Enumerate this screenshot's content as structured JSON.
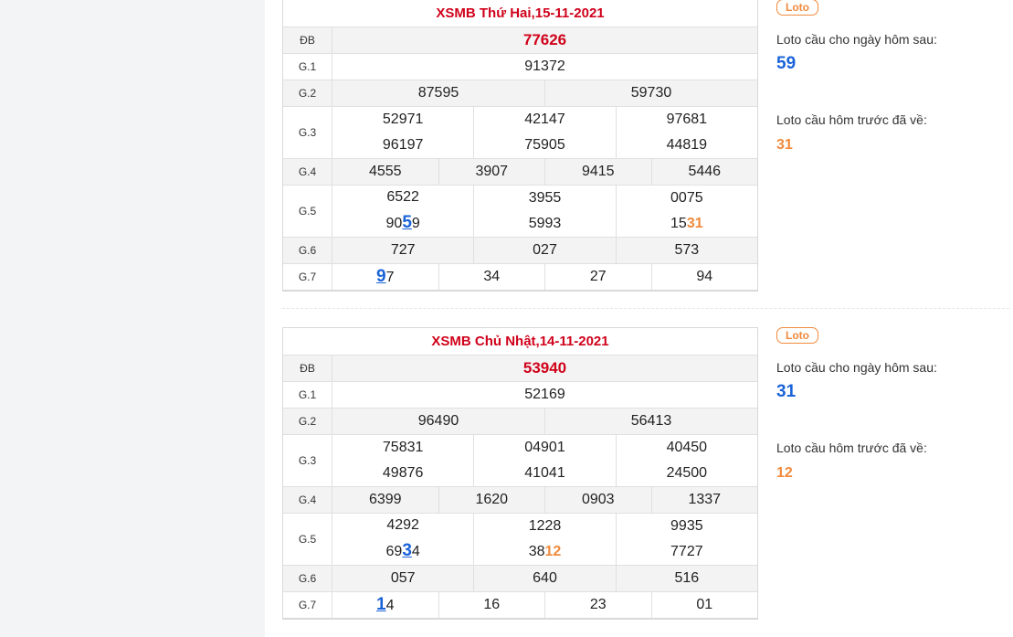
{
  "tables": [
    {
      "title": "XSMB Thứ Hai,15-11-2021",
      "rows": [
        {
          "label": "ĐB",
          "cells": [
            "77626"
          ]
        },
        {
          "label": "G.1",
          "cells": [
            "91372"
          ]
        },
        {
          "label": "G.2",
          "cells": [
            "87595",
            "59730"
          ]
        },
        {
          "label": "G.3",
          "cells": [
            [
              "52971",
              "96197"
            ],
            [
              "42147",
              "75905"
            ],
            [
              "97681",
              "44819"
            ]
          ]
        },
        {
          "label": "G.4",
          "cells": [
            "4555",
            "3907",
            "9415",
            "5446"
          ]
        },
        {
          "label": "G.5",
          "cells": [
            [
              "6522",
              {
                "parts": [
                  [
                    "90",
                    ""
                  ],
                  [
                    "5",
                    "blue"
                  ],
                  [
                    "9",
                    ""
                  ]
                ]
              }
            ],
            [
              "3955",
              "5993"
            ],
            [
              "0075",
              {
                "parts": [
                  [
                    "15",
                    ""
                  ],
                  [
                    "31",
                    "orange"
                  ]
                ]
              }
            ]
          ]
        },
        {
          "label": "G.6",
          "cells": [
            "727",
            "027",
            "573"
          ]
        },
        {
          "label": "G.7",
          "cells": [
            {
              "parts": [
                [
                  "9",
                  "blue"
                ],
                [
                  "7",
                  ""
                ]
              ]
            },
            "34",
            "27",
            "94"
          ]
        }
      ],
      "side": {
        "tag": "Loto",
        "next_label": "Loto cầu cho ngày hôm sau:",
        "next_value": "59",
        "prev_label": "Loto cầu hôm trước đã về:",
        "prev_value": "31"
      }
    },
    {
      "title": "XSMB Chủ Nhật,14-11-2021",
      "rows": [
        {
          "label": "ĐB",
          "cells": [
            "53940"
          ]
        },
        {
          "label": "G.1",
          "cells": [
            "52169"
          ]
        },
        {
          "label": "G.2",
          "cells": [
            "96490",
            "56413"
          ]
        },
        {
          "label": "G.3",
          "cells": [
            [
              "75831",
              "49876"
            ],
            [
              "04901",
              "41041"
            ],
            [
              "40450",
              "24500"
            ]
          ]
        },
        {
          "label": "G.4",
          "cells": [
            "6399",
            "1620",
            "0903",
            "1337"
          ]
        },
        {
          "label": "G.5",
          "cells": [
            [
              "4292",
              {
                "parts": [
                  [
                    "69",
                    ""
                  ],
                  [
                    "3",
                    "blue"
                  ],
                  [
                    "4",
                    ""
                  ]
                ]
              }
            ],
            [
              "1228",
              {
                "parts": [
                  [
                    "38",
                    ""
                  ],
                  [
                    "12",
                    "orange"
                  ]
                ]
              }
            ],
            [
              "9935",
              "7727"
            ]
          ]
        },
        {
          "label": "G.6",
          "cells": [
            "057",
            "640",
            "516"
          ]
        },
        {
          "label": "G.7",
          "cells": [
            {
              "parts": [
                [
                  "1",
                  "blue"
                ],
                [
                  "4",
                  ""
                ]
              ]
            },
            "16",
            "23",
            "01"
          ]
        }
      ],
      "side": {
        "tag": "Loto",
        "next_label": "Loto cầu cho ngày hôm sau:",
        "next_value": "31",
        "prev_label": "Loto cầu hôm trước đã về:",
        "prev_value": "12"
      }
    }
  ]
}
